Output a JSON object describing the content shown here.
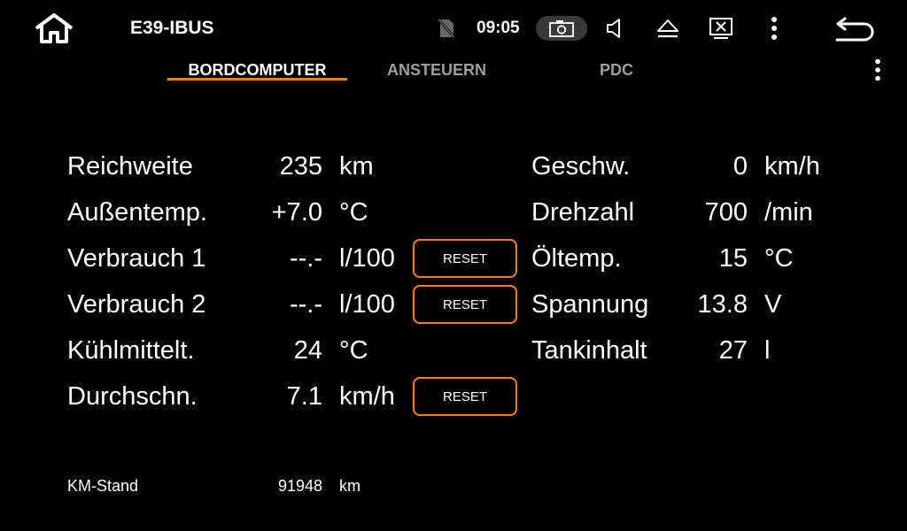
{
  "statusbar": {
    "app_title": "E39-IBUS",
    "time": "09:05",
    "icons": [
      "home-icon",
      "no-sim-icon",
      "screenshot-icon",
      "volume-icon",
      "eject-icon",
      "close-window-icon",
      "more-vert-icon",
      "back-icon"
    ]
  },
  "tabs": [
    {
      "label": "BORDCOMPUTER",
      "active": true
    },
    {
      "label": "ANSTEUERN",
      "active": false
    },
    {
      "label": "PDC",
      "active": false
    }
  ],
  "left": [
    {
      "label": "Reichweite",
      "value": "235",
      "unit": "km",
      "reset": ""
    },
    {
      "label": "Außentemp.",
      "value": "+7.0",
      "unit": "°C",
      "reset": ""
    },
    {
      "label": "Verbrauch 1",
      "value": "--.-",
      "unit": "l/100",
      "reset": "RESET"
    },
    {
      "label": "Verbrauch 2",
      "value": "--.-",
      "unit": "l/100",
      "reset": "RESET"
    },
    {
      "label": "Kühlmittelt.",
      "value": "24",
      "unit": "°C",
      "reset": ""
    },
    {
      "label": "Durchschn.",
      "value": "7.1",
      "unit": "km/h",
      "reset": "RESET"
    }
  ],
  "right": [
    {
      "label": "Geschw.",
      "value": "0",
      "unit": "km/h"
    },
    {
      "label": "Drehzahl",
      "value": "700",
      "unit": "/min"
    },
    {
      "label": "Öltemp.",
      "value": "15",
      "unit": "°C"
    },
    {
      "label": "Spannung",
      "value": "13.8",
      "unit": "V"
    },
    {
      "label": "Tankinhalt",
      "value": "27",
      "unit": "l"
    }
  ],
  "odometer": {
    "label": "KM-Stand",
    "value": "91948",
    "unit": "km"
  },
  "colors": {
    "accent": "#ff7f00",
    "background": "#000000",
    "inactive_tab": "#9e9e9e"
  }
}
